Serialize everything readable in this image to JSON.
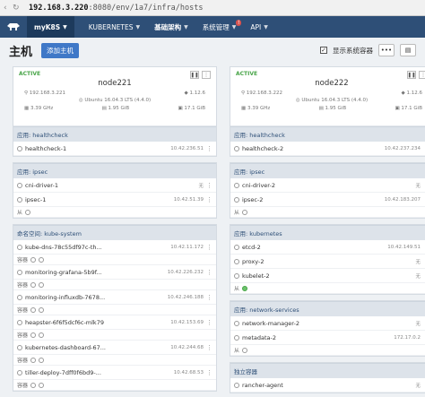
{
  "browser": {
    "url_host": "192.168.3.220",
    "url_rest": ":8080/env/1a7/infra/hosts"
  },
  "header": {
    "env": "myK8S",
    "menu": [
      {
        "label": "KUBERNETES"
      },
      {
        "label": "基础架构"
      },
      {
        "label": "系统管理",
        "badge": "!"
      },
      {
        "label": "API"
      }
    ]
  },
  "page": {
    "title": "主机",
    "add_button": "添加主机",
    "show_system": "显示系统容器"
  },
  "hosts": [
    {
      "state": "ACTIVE",
      "name": "node221",
      "ip": "192.168.3.221",
      "version": "1.12.6",
      "os": "Ubuntu 16.04.3 LTS (4.4.0)",
      "cpu": "3.39 GHz",
      "ram": "1.95 GiB",
      "disk": "17.1 GiB",
      "groups": [
        {
          "title": "应用: healthcheck",
          "rows": [
            {
              "name": "healthcheck-1",
              "ip": "10.42.236.51",
              "tag": ""
            }
          ]
        },
        {
          "title": "应用: ipsec",
          "rows": [
            {
              "name": "cni-driver-1",
              "ip": "",
              "tag": "无"
            },
            {
              "name": "ipsec-1",
              "ip": "10.42.51.39",
              "tag": ""
            }
          ],
          "sub": "从"
        },
        {
          "title": "命名空间: kube-system",
          "rows": [
            {
              "name": "kube-dns-78c55df97c-th...",
              "ip": "10.42.11.172",
              "tag": ""
            },
            {
              "name": "monitoring-grafana-5b9f...",
              "ip": "10.42.226.232",
              "tag": ""
            },
            {
              "name": "monitoring-influxdb-7678...",
              "ip": "10.42.246.188",
              "tag": ""
            },
            {
              "name": "heapster-6f6f5dcf6c-mlk79",
              "ip": "10.42.153.69",
              "tag": ""
            },
            {
              "name": "kubernetes-dashboard-67...",
              "ip": "10.42.244.68",
              "tag": ""
            },
            {
              "name": "tiller-deploy-7dff0f6bd9-...",
              "ip": "10.42.68.53",
              "tag": ""
            }
          ],
          "sub": "容器"
        }
      ]
    },
    {
      "state": "ACTIVE",
      "name": "node222",
      "ip": "192.168.3.222",
      "version": "1.12.6",
      "os": "Ubuntu 16.04.3 LTS (4.4.0)",
      "cpu": "3.39 GHz",
      "ram": "1.95 GiB",
      "disk": "17.1 GiB",
      "groups": [
        {
          "title": "应用: healthcheck",
          "rows": [
            {
              "name": "healthcheck-2",
              "ip": "10.42.237.234",
              "tag": ""
            }
          ]
        },
        {
          "title": "应用: ipsec",
          "rows": [
            {
              "name": "cni-driver-2",
              "ip": "",
              "tag": "无"
            },
            {
              "name": "ipsec-2",
              "ip": "10.42.183.207",
              "tag": ""
            }
          ],
          "sub": "从"
        },
        {
          "title": "应用: kubernetes",
          "rows": [
            {
              "name": "etcd-2",
              "ip": "10.42.149.51",
              "tag": ""
            },
            {
              "name": "proxy-2",
              "ip": "",
              "tag": "无"
            },
            {
              "name": "kubelet-2",
              "ip": "",
              "tag": "无"
            }
          ],
          "sub": "从"
        },
        {
          "title": "应用: network-services",
          "rows": [
            {
              "name": "network-manager-2",
              "ip": "",
              "tag": "无"
            },
            {
              "name": "metadata-2",
              "ip": "172.17.0.2",
              "tag": ""
            }
          ],
          "sub": "从"
        },
        {
          "title": "独立容器",
          "rows": [
            {
              "name": "rancher-agent",
              "ip": "",
              "tag": "无"
            }
          ]
        }
      ]
    }
  ]
}
